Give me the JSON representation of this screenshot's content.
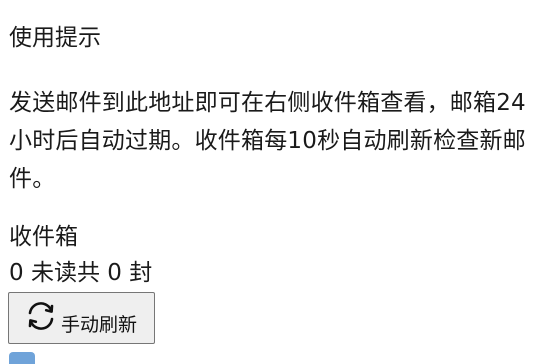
{
  "tips": {
    "title": "使用提示",
    "text": "发送邮件到此地址即可在右侧收件箱查看，邮箱24小时后自动过期。收件箱每10秒自动刷新检查新邮件。"
  },
  "inbox": {
    "title": "收件箱",
    "unread_count": "0",
    "unread_label": "未读",
    "total_prefix": "共",
    "total_count": "0",
    "total_suffix": "封",
    "refresh_label": "手动刷新",
    "refresh_icon": "refresh-icon"
  },
  "colors": {
    "button_bg": "#efefef",
    "button_border": "#767676",
    "accent": "#6fa3d9"
  }
}
